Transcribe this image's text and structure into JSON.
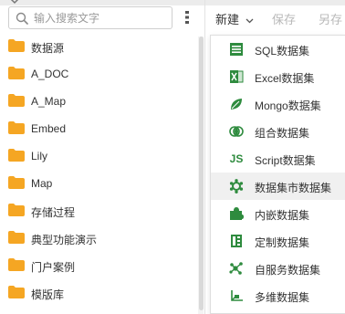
{
  "colors": {
    "accent_green": "#2e8b3e",
    "folder_orange": "#f5a623",
    "disabled_text": "#b8b8b8"
  },
  "search": {
    "placeholder": "输入搜索文字",
    "value": ""
  },
  "tree": {
    "items": [
      {
        "label": "数据源"
      },
      {
        "label": "A_DOC"
      },
      {
        "label": "A_Map"
      },
      {
        "label": "Embed"
      },
      {
        "label": "Lily"
      },
      {
        "label": "Map"
      },
      {
        "label": "存储过程"
      },
      {
        "label": "典型功能演示"
      },
      {
        "label": "门户案例"
      },
      {
        "label": "模版库"
      }
    ]
  },
  "toolbar": {
    "new_label": "新建",
    "save_label": "保存",
    "saveas_label": "另存"
  },
  "menu": {
    "items": [
      {
        "label": "SQL数据集",
        "icon": "sql-table-icon"
      },
      {
        "label": "Excel数据集",
        "icon": "excel-icon"
      },
      {
        "label": "Mongo数据集",
        "icon": "mongo-leaf-icon"
      },
      {
        "label": "组合数据集",
        "icon": "combine-icon"
      },
      {
        "label": "Script数据集",
        "icon": "script-js-icon",
        "glyph": "JS"
      },
      {
        "label": "数据集市数据集",
        "icon": "datamart-icon",
        "active": true
      },
      {
        "label": "内嵌数据集",
        "icon": "puzzle-icon"
      },
      {
        "label": "定制数据集",
        "icon": "custom-icon"
      },
      {
        "label": "自服务数据集",
        "icon": "self-service-icon"
      },
      {
        "label": "多维数据集",
        "icon": "multidim-icon"
      }
    ]
  }
}
